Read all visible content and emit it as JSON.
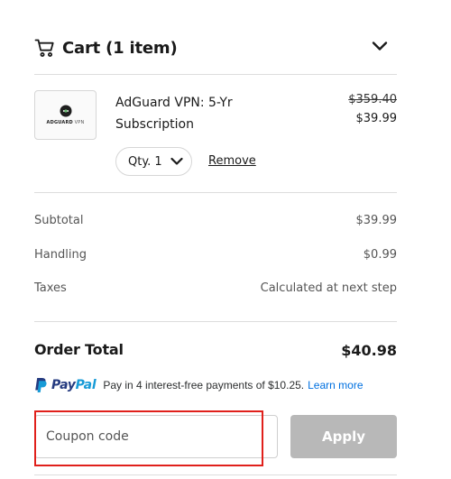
{
  "cart": {
    "title": "Cart (1 item)",
    "icon": "shopping-cart-icon",
    "toggle_icon": "chevron-down-icon"
  },
  "item": {
    "thumb_brand_bold": "ADGUARD",
    "thumb_brand_thin": " VPN",
    "name": "AdGuard VPN: 5-Yr Subscription",
    "original_price": "$359.40",
    "price": "$39.99",
    "qty_label": "Qty. 1",
    "remove_label": "Remove"
  },
  "summary": {
    "rows": [
      {
        "label": "Subtotal",
        "value": "$39.99"
      },
      {
        "label": "Handling",
        "value": "$0.99"
      },
      {
        "label": "Taxes",
        "value": "Calculated at next step"
      }
    ],
    "total_label": "Order Total",
    "total_value": "$40.98"
  },
  "paypal": {
    "word_pay": "Pay",
    "word_pal": "Pal",
    "message": "Pay in 4 interest-free payments of $10.25.",
    "learn_more": "Learn more",
    "colors": {
      "dark_blue": "#253b80",
      "light_blue": "#179bd7",
      "link": "#0070e0"
    }
  },
  "coupon": {
    "placeholder": "Coupon code",
    "apply_label": "Apply",
    "highlight_color": "#e0201b"
  }
}
